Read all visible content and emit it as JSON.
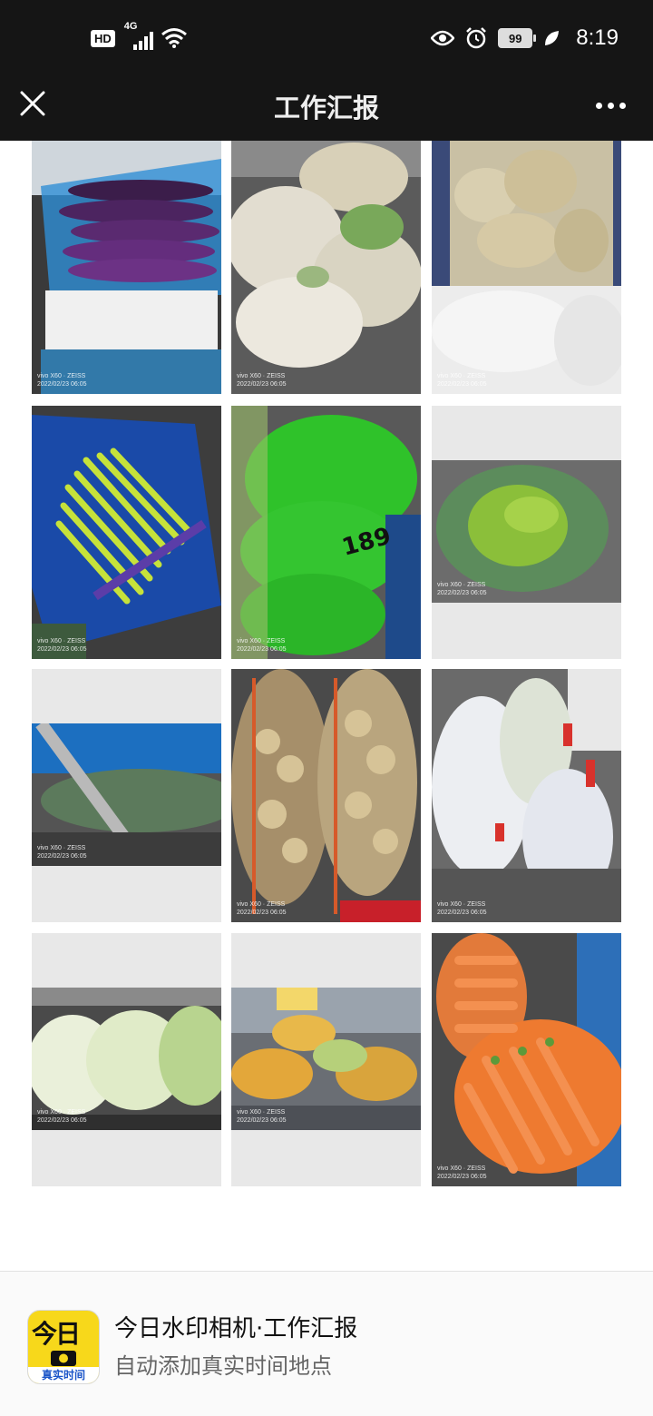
{
  "status_bar": {
    "hd_label": "HD",
    "network_label": "4G",
    "battery_level": "99",
    "time": "8:19"
  },
  "header": {
    "title": "工作汇报"
  },
  "photos": [
    {
      "name": "eggplant",
      "watermark_brand": "vivo X60 · ZEISS",
      "watermark_time": "2022/02/23 06:05"
    },
    {
      "name": "cauliflower",
      "watermark_brand": "vivo X60 · ZEISS",
      "watermark_time": "2022/02/23 06:05"
    },
    {
      "name": "bamboo-shoots",
      "watermark_brand": "vivo X60 · ZEISS",
      "watermark_time": "2022/02/23 06:05"
    },
    {
      "name": "garlic-sprouts",
      "watermark_brand": "vivo X60 · ZEISS",
      "watermark_time": "2022/02/23 06:05"
    },
    {
      "name": "green-bags",
      "watermark_brand": "vivo X60 · ZEISS",
      "watermark_time": "2022/02/23 06:05",
      "bag_label": "189"
    },
    {
      "name": "green-peas",
      "watermark_brand": "vivo X60 · ZEISS",
      "watermark_time": "2022/02/23 06:05"
    },
    {
      "name": "wax-gourd",
      "watermark_brand": "vivo X60 · ZEISS",
      "watermark_time": "2022/02/23 06:05"
    },
    {
      "name": "potatoes",
      "watermark_brand": "vivo X60 · ZEISS",
      "watermark_time": "2022/02/23 06:05"
    },
    {
      "name": "white-radish",
      "watermark_brand": "vivo X60 · ZEISS",
      "watermark_time": "2022/02/23 06:05"
    },
    {
      "name": "napa-cabbage",
      "watermark_brand": "vivo X60 · ZEISS",
      "watermark_time": "2022/02/23 06:05"
    },
    {
      "name": "cabbage-nets",
      "watermark_brand": "vivo X60 · ZEISS",
      "watermark_time": "2022/02/23 06:05"
    },
    {
      "name": "carrots",
      "watermark_brand": "vivo X60 · ZEISS",
      "watermark_time": "2022/02/23 06:05"
    }
  ],
  "footer": {
    "app_name": "今日水印相机·工作汇报",
    "subtitle": "自动添加真实时间地点",
    "logo_top": "今日",
    "logo_bottom": "真实时间"
  }
}
